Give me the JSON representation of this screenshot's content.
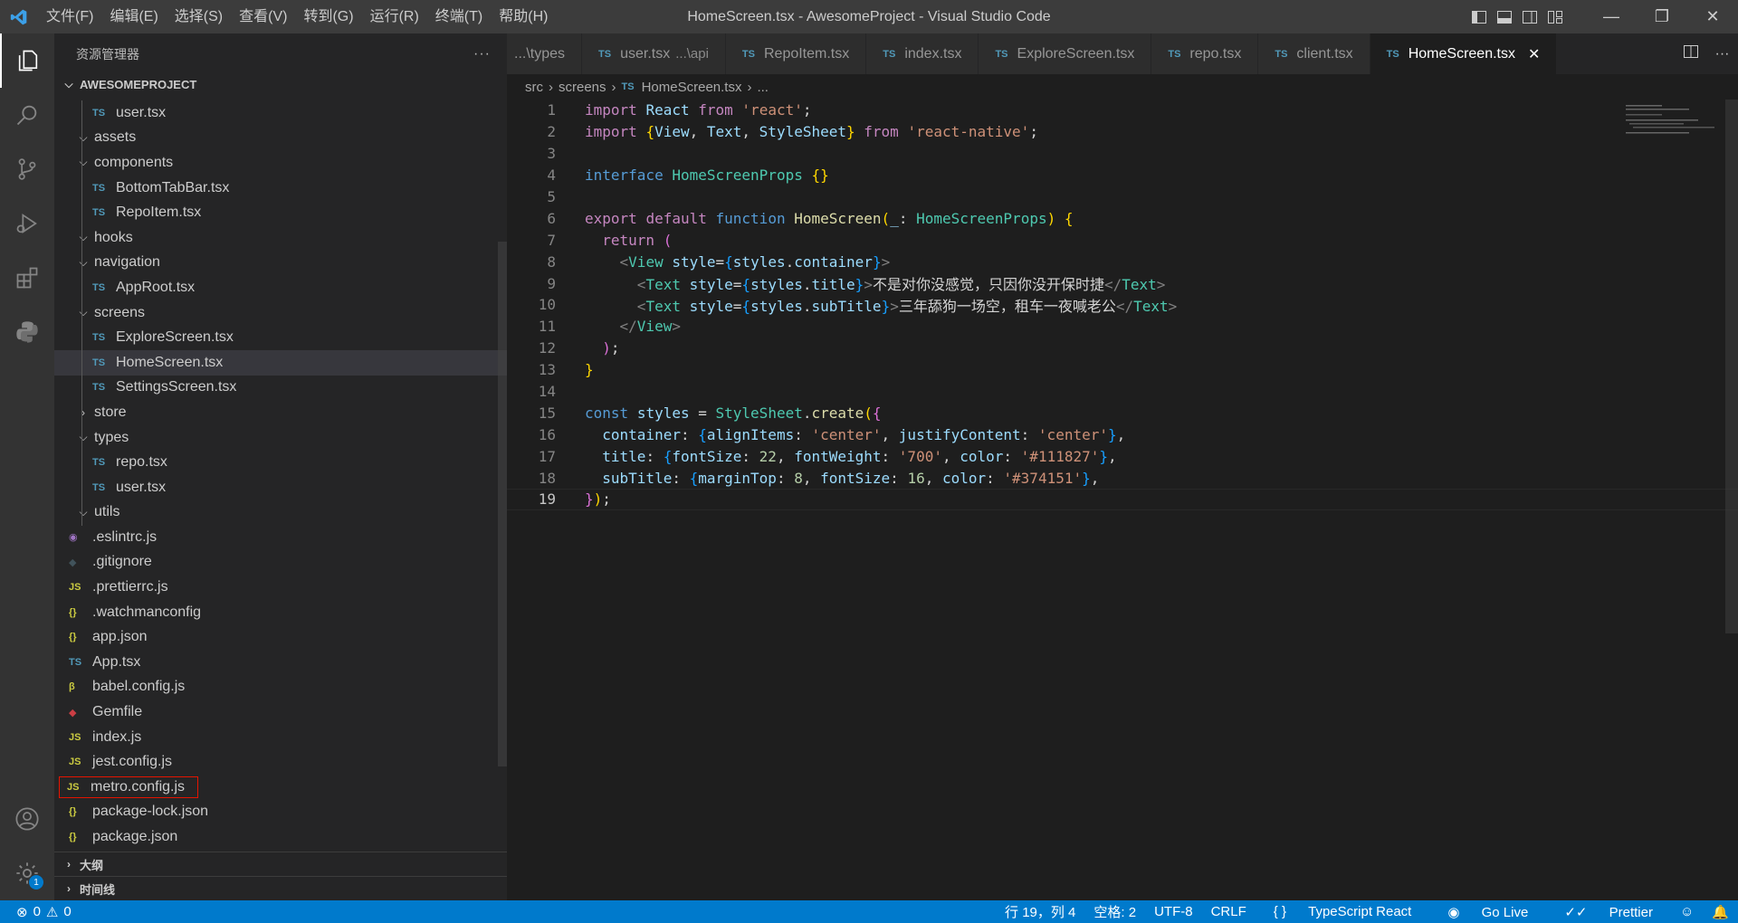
{
  "window": {
    "title": "HomeScreen.tsx - AwesomeProject - Visual Studio Code",
    "menu": [
      "文件(F)",
      "编辑(E)",
      "选择(S)",
      "查看(V)",
      "转到(G)",
      "运行(R)",
      "终端(T)",
      "帮助(H)"
    ],
    "controls": {
      "minimize": "—",
      "restore": "❐",
      "close": "✕"
    }
  },
  "activity_bar": {
    "items": [
      "explorer-icon",
      "search-icon",
      "source-control-icon",
      "run-debug-icon",
      "extensions-icon",
      "python-icon"
    ],
    "bottom": [
      "account-icon",
      "settings-gear-icon"
    ],
    "settings_badge": "1"
  },
  "explorer": {
    "title": "资源管理器",
    "more": "···",
    "project": "AWESOMEPROJECT",
    "tree": [
      {
        "label": "user.tsx",
        "icon": "TS",
        "type": "ts",
        "depth": 2
      },
      {
        "label": "assets",
        "chevron": "open",
        "depth": 1
      },
      {
        "label": "components",
        "chevron": "open",
        "depth": 1
      },
      {
        "label": "BottomTabBar.tsx",
        "icon": "TS",
        "type": "ts",
        "depth": 2
      },
      {
        "label": "RepoItem.tsx",
        "icon": "TS",
        "type": "ts",
        "depth": 2
      },
      {
        "label": "hooks",
        "chevron": "open",
        "depth": 1
      },
      {
        "label": "navigation",
        "chevron": "open",
        "depth": 1
      },
      {
        "label": "AppRoot.tsx",
        "icon": "TS",
        "type": "ts",
        "depth": 2
      },
      {
        "label": "screens",
        "chevron": "open",
        "depth": 1
      },
      {
        "label": "ExploreScreen.tsx",
        "icon": "TS",
        "type": "ts",
        "depth": 2
      },
      {
        "label": "HomeScreen.tsx",
        "icon": "TS",
        "type": "ts",
        "depth": 2,
        "selected": true
      },
      {
        "label": "SettingsScreen.tsx",
        "icon": "TS",
        "type": "ts",
        "depth": 2
      },
      {
        "label": "store",
        "chevron": "closed",
        "depth": 1
      },
      {
        "label": "types",
        "chevron": "open",
        "depth": 1
      },
      {
        "label": "repo.tsx",
        "icon": "TS",
        "type": "ts",
        "depth": 2
      },
      {
        "label": "user.tsx",
        "icon": "TS",
        "type": "ts",
        "depth": 2
      },
      {
        "label": "utils",
        "chevron": "open",
        "depth": 1
      },
      {
        "label": ".eslintrc.js",
        "icon": "◉",
        "type": "eslint",
        "depth": 0
      },
      {
        "label": ".gitignore",
        "icon": "◆",
        "type": "git",
        "depth": 0
      },
      {
        "label": ".prettierrc.js",
        "icon": "JS",
        "type": "js",
        "depth": 0
      },
      {
        "label": ".watchmanconfig",
        "icon": "{}",
        "type": "json",
        "depth": 0
      },
      {
        "label": "app.json",
        "icon": "{}",
        "type": "json",
        "depth": 0
      },
      {
        "label": "App.tsx",
        "icon": "TS",
        "type": "ts",
        "depth": 0
      },
      {
        "label": "babel.config.js",
        "icon": "β",
        "type": "babel",
        "depth": 0
      },
      {
        "label": "Gemfile",
        "icon": "◆",
        "type": "gem",
        "depth": 0
      },
      {
        "label": "index.js",
        "icon": "JS",
        "type": "js",
        "depth": 0
      },
      {
        "label": "jest.config.js",
        "icon": "JS",
        "type": "js",
        "depth": 0
      },
      {
        "label": "metro.config.js",
        "icon": "JS",
        "type": "js",
        "depth": 0,
        "highlighted": true
      },
      {
        "label": "package-lock.json",
        "icon": "{}",
        "type": "json",
        "depth": 0
      },
      {
        "label": "package.json",
        "icon": "{}",
        "type": "json",
        "depth": 0
      }
    ],
    "sections": [
      "大纲",
      "时间线"
    ]
  },
  "tabs": [
    {
      "label": "...\\types",
      "icon": "",
      "hint": ""
    },
    {
      "label": "user.tsx",
      "icon": "TS",
      "hint": "...\\api"
    },
    {
      "label": "RepoItem.tsx",
      "icon": "TS",
      "hint": ""
    },
    {
      "label": "index.tsx",
      "icon": "TS",
      "hint": ""
    },
    {
      "label": "ExploreScreen.tsx",
      "icon": "TS",
      "hint": ""
    },
    {
      "label": "repo.tsx",
      "icon": "TS",
      "hint": ""
    },
    {
      "label": "client.tsx",
      "icon": "TS",
      "hint": ""
    },
    {
      "label": "HomeScreen.tsx",
      "icon": "TS",
      "hint": "",
      "active": true
    }
  ],
  "breadcrumb": [
    "src",
    "screens",
    "HomeScreen.tsx",
    "..."
  ],
  "editor": {
    "current_line": 19,
    "lines": [
      [
        [
          "kw",
          "import"
        ],
        [
          "pu",
          " "
        ],
        [
          "id",
          "React"
        ],
        [
          "pu",
          " "
        ],
        [
          "kw",
          "from"
        ],
        [
          "pu",
          " "
        ],
        [
          "st",
          "'react'"
        ],
        [
          "pu",
          ";"
        ]
      ],
      [
        [
          "kw",
          "import"
        ],
        [
          "pu",
          " "
        ],
        [
          "br1",
          "{"
        ],
        [
          "id",
          "View"
        ],
        [
          "pu",
          ", "
        ],
        [
          "id",
          "Text"
        ],
        [
          "pu",
          ", "
        ],
        [
          "id",
          "StyleSheet"
        ],
        [
          "br1",
          "}"
        ],
        [
          "pu",
          " "
        ],
        [
          "kw",
          "from"
        ],
        [
          "pu",
          " "
        ],
        [
          "st",
          "'react-native'"
        ],
        [
          "pu",
          ";"
        ]
      ],
      [],
      [
        [
          "kb",
          "interface"
        ],
        [
          "pu",
          " "
        ],
        [
          "ty",
          "HomeScreenProps"
        ],
        [
          "pu",
          " "
        ],
        [
          "br1",
          "{}"
        ]
      ],
      [],
      [
        [
          "kw",
          "export"
        ],
        [
          "pu",
          " "
        ],
        [
          "kw",
          "default"
        ],
        [
          "pu",
          " "
        ],
        [
          "kb",
          "function"
        ],
        [
          "pu",
          " "
        ],
        [
          "fn",
          "HomeScreen"
        ],
        [
          "br1",
          "("
        ],
        [
          "id",
          "_"
        ],
        [
          "pu",
          ": "
        ],
        [
          "ty",
          "HomeScreenProps"
        ],
        [
          "br1",
          ")"
        ],
        [
          "pu",
          " "
        ],
        [
          "br1",
          "{"
        ]
      ],
      [
        [
          "pu",
          "  "
        ],
        [
          "kw",
          "return"
        ],
        [
          "pu",
          " "
        ],
        [
          "br2",
          "("
        ]
      ],
      [
        [
          "pu",
          "    "
        ],
        [
          "tg",
          "<"
        ],
        [
          "tag",
          "View"
        ],
        [
          "pu",
          " "
        ],
        [
          "id",
          "style"
        ],
        [
          "pu",
          "="
        ],
        [
          "br3",
          "{"
        ],
        [
          "id",
          "styles"
        ],
        [
          "pu",
          "."
        ],
        [
          "id",
          "container"
        ],
        [
          "br3",
          "}"
        ],
        [
          "tg",
          ">"
        ]
      ],
      [
        [
          "pu",
          "      "
        ],
        [
          "tg",
          "<"
        ],
        [
          "tag",
          "Text"
        ],
        [
          "pu",
          " "
        ],
        [
          "id",
          "style"
        ],
        [
          "pu",
          "="
        ],
        [
          "br3",
          "{"
        ],
        [
          "id",
          "styles"
        ],
        [
          "pu",
          "."
        ],
        [
          "id",
          "title"
        ],
        [
          "br3",
          "}"
        ],
        [
          "tg",
          ">"
        ],
        [
          "pu",
          "不是对你没感觉，只因你没开保时捷"
        ],
        [
          "tg",
          "</"
        ],
        [
          "tag",
          "Text"
        ],
        [
          "tg",
          ">"
        ]
      ],
      [
        [
          "pu",
          "      "
        ],
        [
          "tg",
          "<"
        ],
        [
          "tag",
          "Text"
        ],
        [
          "pu",
          " "
        ],
        [
          "id",
          "style"
        ],
        [
          "pu",
          "="
        ],
        [
          "br3",
          "{"
        ],
        [
          "id",
          "styles"
        ],
        [
          "pu",
          "."
        ],
        [
          "id",
          "subTitle"
        ],
        [
          "br3",
          "}"
        ],
        [
          "tg",
          ">"
        ],
        [
          "pu",
          "三年舔狗一场空，租车一夜喊老公"
        ],
        [
          "tg",
          "</"
        ],
        [
          "tag",
          "Text"
        ],
        [
          "tg",
          ">"
        ]
      ],
      [
        [
          "pu",
          "    "
        ],
        [
          "tg",
          "</"
        ],
        [
          "tag",
          "View"
        ],
        [
          "tg",
          ">"
        ]
      ],
      [
        [
          "pu",
          "  "
        ],
        [
          "br2",
          ")"
        ],
        [
          "pu",
          ";"
        ]
      ],
      [
        [
          "br1",
          "}"
        ]
      ],
      [],
      [
        [
          "kb",
          "const"
        ],
        [
          "pu",
          " "
        ],
        [
          "id",
          "styles"
        ],
        [
          "pu",
          " = "
        ],
        [
          "ty",
          "StyleSheet"
        ],
        [
          "pu",
          "."
        ],
        [
          "fn",
          "create"
        ],
        [
          "br1",
          "("
        ],
        [
          "br2",
          "{"
        ]
      ],
      [
        [
          "pu",
          "  "
        ],
        [
          "id",
          "container"
        ],
        [
          "pu",
          ": "
        ],
        [
          "br3",
          "{"
        ],
        [
          "id",
          "alignItems"
        ],
        [
          "pu",
          ": "
        ],
        [
          "st",
          "'center'"
        ],
        [
          "pu",
          ", "
        ],
        [
          "id",
          "justifyContent"
        ],
        [
          "pu",
          ": "
        ],
        [
          "st",
          "'center'"
        ],
        [
          "br3",
          "}"
        ],
        [
          "pu",
          ","
        ]
      ],
      [
        [
          "pu",
          "  "
        ],
        [
          "id",
          "title"
        ],
        [
          "pu",
          ": "
        ],
        [
          "br3",
          "{"
        ],
        [
          "id",
          "fontSize"
        ],
        [
          "pu",
          ": "
        ],
        [
          "nu",
          "22"
        ],
        [
          "pu",
          ", "
        ],
        [
          "id",
          "fontWeight"
        ],
        [
          "pu",
          ": "
        ],
        [
          "st",
          "'700'"
        ],
        [
          "pu",
          ", "
        ],
        [
          "id",
          "color"
        ],
        [
          "pu",
          ": "
        ],
        [
          "st",
          "'#111827'"
        ],
        [
          "br3",
          "}"
        ],
        [
          "pu",
          ","
        ]
      ],
      [
        [
          "pu",
          "  "
        ],
        [
          "id",
          "subTitle"
        ],
        [
          "pu",
          ": "
        ],
        [
          "br3",
          "{"
        ],
        [
          "id",
          "marginTop"
        ],
        [
          "pu",
          ": "
        ],
        [
          "nu",
          "8"
        ],
        [
          "pu",
          ", "
        ],
        [
          "id",
          "fontSize"
        ],
        [
          "pu",
          ": "
        ],
        [
          "nu",
          "16"
        ],
        [
          "pu",
          ", "
        ],
        [
          "id",
          "color"
        ],
        [
          "pu",
          ": "
        ],
        [
          "st",
          "'#374151'"
        ],
        [
          "br3",
          "}"
        ],
        [
          "pu",
          ","
        ]
      ],
      [
        [
          "br2",
          "}"
        ],
        [
          "br1",
          ")"
        ],
        [
          "pu",
          ";"
        ]
      ]
    ]
  },
  "status": {
    "errors": "0",
    "warnings": "0",
    "position": "行 19，列 4",
    "spaces": "空格: 2",
    "encoding": "UTF-8",
    "eol": "CRLF",
    "language": "TypeScript React",
    "golive": "Go Live",
    "prettier": "Prettier"
  },
  "colors": {
    "statusbar": "#007acc",
    "accent": "#007acc"
  }
}
